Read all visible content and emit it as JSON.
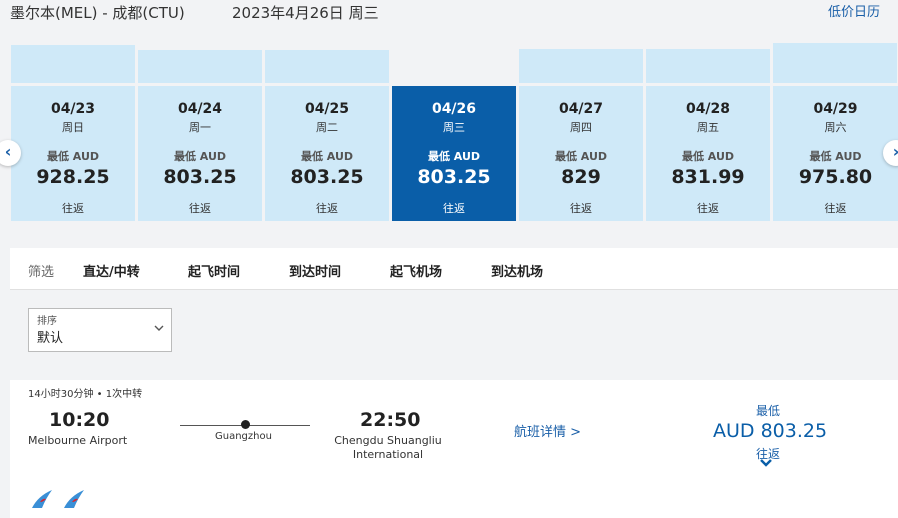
{
  "header": {
    "route": "墨尔本(MEL) - 成都(CTU)",
    "date": "2023年4月26日 周三",
    "low_price_calendar": "低价日历"
  },
  "dates": [
    {
      "date": "04/23",
      "weekday": "周日",
      "label": "最低 AUD",
      "price": "928.25",
      "trip": "往返",
      "level": 0.83,
      "selected": false
    },
    {
      "date": "04/24",
      "weekday": "周一",
      "label": "最低 AUD",
      "price": "803.25",
      "trip": "往返",
      "level": 0.72,
      "selected": false
    },
    {
      "date": "04/25",
      "weekday": "周二",
      "label": "最低 AUD",
      "price": "803.25",
      "trip": "往返",
      "level": 0.72,
      "selected": false
    },
    {
      "date": "04/26",
      "weekday": "周三",
      "label": "最低 AUD",
      "price": "803.25",
      "trip": "往返",
      "level": 0.72,
      "selected": true
    },
    {
      "date": "04/27",
      "weekday": "周四",
      "label": "最低 AUD",
      "price": "829",
      "trip": "往返",
      "level": 0.74,
      "selected": false
    },
    {
      "date": "04/28",
      "weekday": "周五",
      "label": "最低 AUD",
      "price": "831.99",
      "trip": "往返",
      "level": 0.75,
      "selected": false
    },
    {
      "date": "04/29",
      "weekday": "周六",
      "label": "最低 AUD",
      "price": "975.80",
      "trip": "往返",
      "level": 0.87,
      "selected": false
    }
  ],
  "filters": {
    "label": "筛选",
    "items": [
      "直达/中转",
      "起飞时间",
      "到达时间",
      "起飞机场",
      "到达机场"
    ]
  },
  "sort": {
    "label": "排序",
    "value": "默认"
  },
  "flight": {
    "duration": "14小时30分钟 • 1次中转",
    "depart_time": "10:20",
    "depart_airport": "Melbourne Airport",
    "via": "Guangzhou",
    "arrive_time": "22:50",
    "arrive_airport_line1": "Chengdu Shuangliu",
    "arrive_airport_line2": "International",
    "details_link": "航班详情 >",
    "price_label": "最低",
    "price": "AUD 803.25",
    "trip_type": "往返"
  },
  "icons": {
    "prev": "chevron-left-icon",
    "next": "chevron-right-icon",
    "dropdown": "chevron-down-icon",
    "expand": "chevron-down-icon",
    "airline": "china-southern-logo"
  },
  "colors": {
    "accent": "#0a5ea8",
    "card_bg": "#cfe9f8",
    "link": "#1a5fa8",
    "airline_blue": "#3a8fd6",
    "airline_red": "#d9232d"
  }
}
